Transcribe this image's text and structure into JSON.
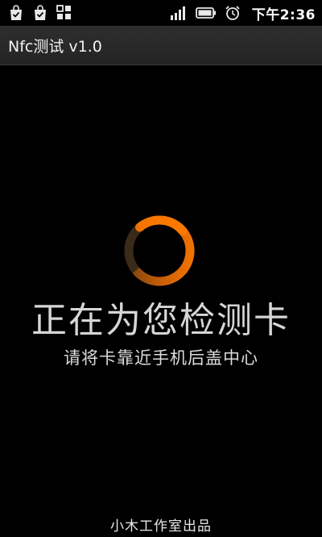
{
  "status_bar": {
    "time": "下午2:36",
    "icons": [
      "shopping-bag-check-icon",
      "shopping-bag-check-icon",
      "grid-icon",
      "signal-icon",
      "battery-icon",
      "alarm-clock-icon"
    ]
  },
  "title_bar": {
    "title": "Nfc测试 v1.0"
  },
  "main": {
    "spinner_icon": "loading-spinner-icon",
    "headline": "正在为您检测卡",
    "subline": "请将卡靠近手机后盖中心"
  },
  "footer": {
    "text": "小木工作室出品"
  },
  "colors": {
    "background": "#000000",
    "accent": "#ff7a00",
    "spinner_track": "#3a2a18",
    "text_primary": "#d6d6d6"
  }
}
